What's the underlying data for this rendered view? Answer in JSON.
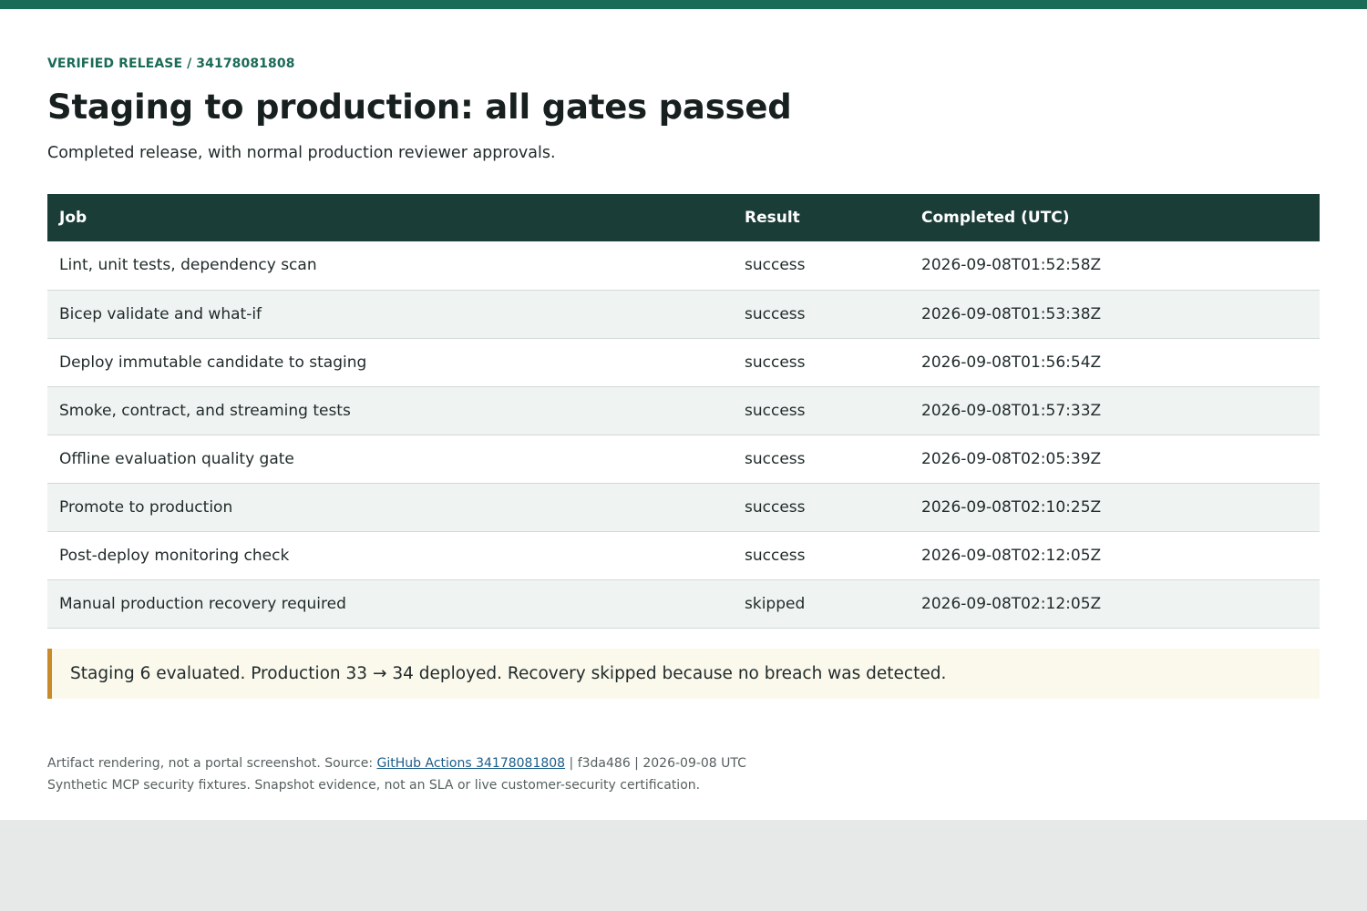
{
  "header": {
    "eyebrow": "VERIFIED RELEASE / 34178081808",
    "title": "Staging to production: all gates passed",
    "subtitle": "Completed release, with normal production reviewer approvals."
  },
  "table": {
    "columns": [
      "Job",
      "Result",
      "Completed (UTC)"
    ],
    "rows": [
      {
        "job": "Lint, unit tests, dependency scan",
        "result": "success",
        "completed": "2026-09-08T01:52:58Z"
      },
      {
        "job": "Bicep validate and what-if",
        "result": "success",
        "completed": "2026-09-08T01:53:38Z"
      },
      {
        "job": "Deploy immutable candidate to staging",
        "result": "success",
        "completed": "2026-09-08T01:56:54Z"
      },
      {
        "job": "Smoke, contract, and streaming tests",
        "result": "success",
        "completed": "2026-09-08T01:57:33Z"
      },
      {
        "job": "Offline evaluation quality gate",
        "result": "success",
        "completed": "2026-09-08T02:05:39Z"
      },
      {
        "job": "Promote to production",
        "result": "success",
        "completed": "2026-09-08T02:10:25Z"
      },
      {
        "job": "Post-deploy monitoring check",
        "result": "success",
        "completed": "2026-09-08T02:12:05Z"
      },
      {
        "job": "Manual production recovery required",
        "result": "skipped",
        "completed": "2026-09-08T02:12:05Z"
      }
    ]
  },
  "summary": {
    "text": "Staging 6 evaluated. Production 33 → 34 deployed. Recovery skipped because no breach was detected."
  },
  "footer": {
    "line1_prefix": "Artifact rendering, not a portal screenshot. Source: ",
    "line1_link": "GitHub Actions 34178081808",
    "line1_suffix": " | f3da486 | 2026-09-08 UTC",
    "line2": "Synthetic MCP security fixtures. Snapshot evidence, not an SLA or live customer-security certification."
  },
  "colors": {
    "accent": "#1a6b57",
    "table_header": "#1b3d37",
    "summary_border": "#c98a2c",
    "summary_bg": "#fbf8ec",
    "link": "#1a5c8a"
  }
}
